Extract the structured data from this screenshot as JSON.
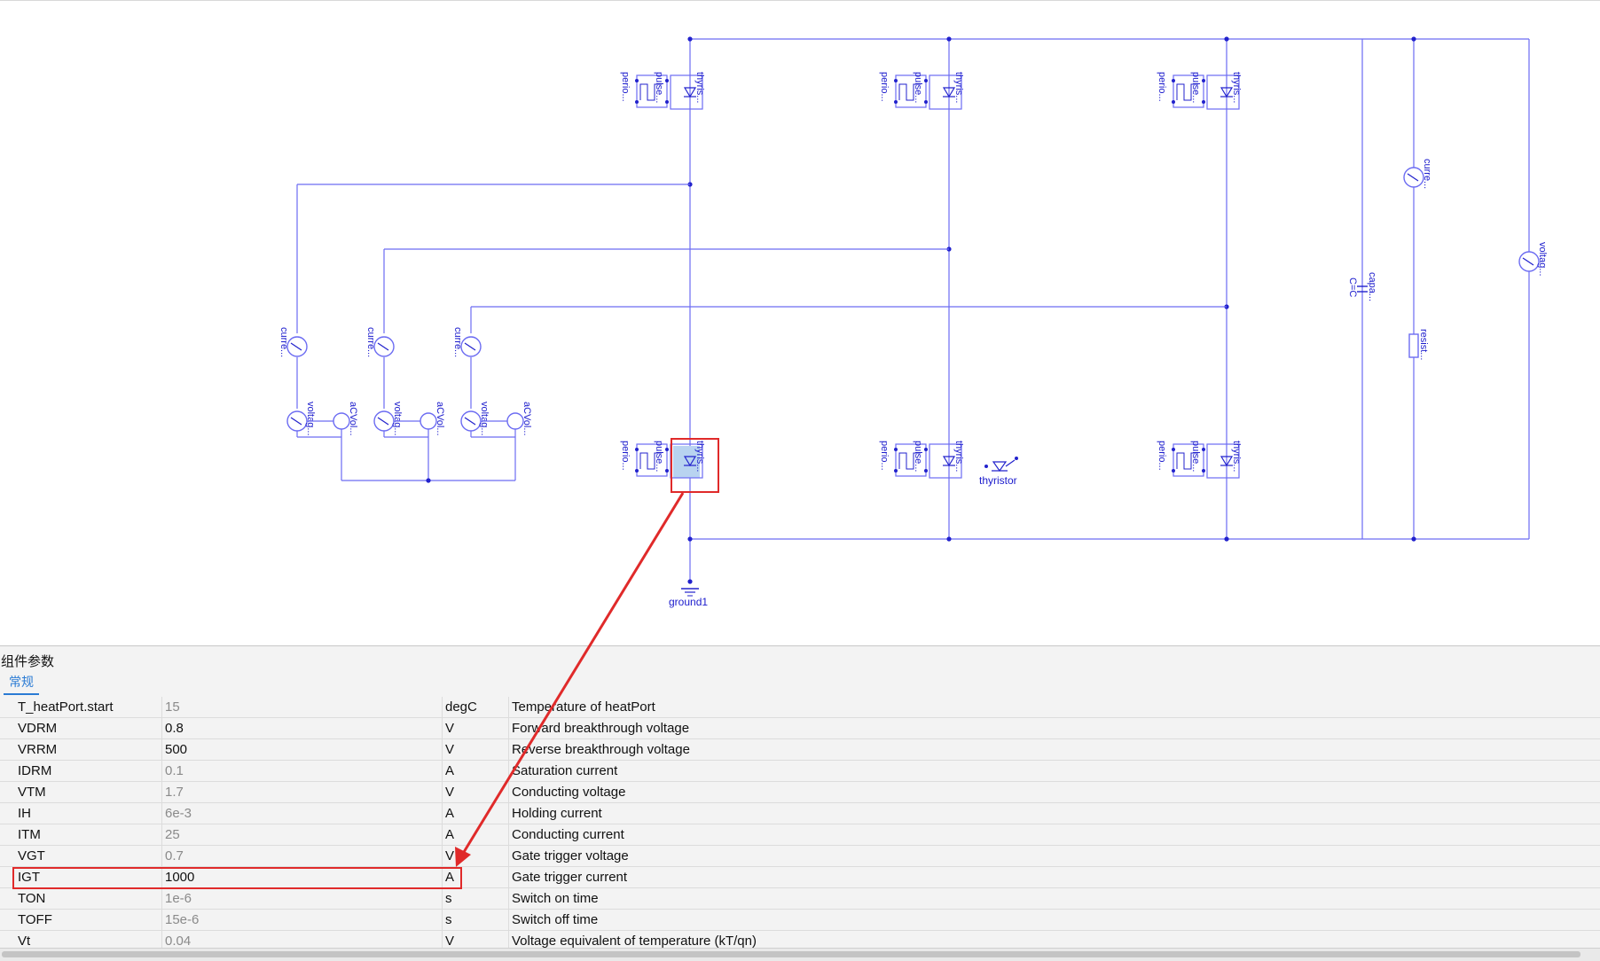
{
  "diagram": {
    "thyristor_top_label": "thyris...",
    "pulse_label": "pulse...",
    "period_label": "perio...",
    "current_sensor_label": "curre...",
    "voltage_sensor_label": "voltag...",
    "ac_source_label": "aCVol...",
    "capacitor_label": "capa...",
    "capacitor_param": "C=C",
    "resistor_label": "resist...",
    "thyristor_unplaced_label": "thyristor",
    "ground_label": "ground1",
    "wire_color": "#6c6cf2",
    "selection_color": "#b8d3f0"
  },
  "panel": {
    "title": "组件参数",
    "tab_general": "常规",
    "rows": [
      {
        "name": "T_heatPort.start",
        "value": "15",
        "unit": "degC",
        "desc": "Temperature of heatPort",
        "is_default": true
      },
      {
        "name": "VDRM",
        "value": "0.8",
        "unit": "V",
        "desc": "Forward breakthrough voltage",
        "is_default": false
      },
      {
        "name": "VRRM",
        "value": "500",
        "unit": "V",
        "desc": "Reverse breakthrough voltage",
        "is_default": false
      },
      {
        "name": "IDRM",
        "value": "0.1",
        "unit": "A",
        "desc": "Saturation current",
        "is_default": true
      },
      {
        "name": "VTM",
        "value": "1.7",
        "unit": "V",
        "desc": "Conducting voltage",
        "is_default": true
      },
      {
        "name": "IH",
        "value": "6e-3",
        "unit": "A",
        "desc": "Holding current",
        "is_default": true
      },
      {
        "name": "ITM",
        "value": "25",
        "unit": "A",
        "desc": "Conducting current",
        "is_default": true
      },
      {
        "name": "VGT",
        "value": "0.7",
        "unit": "V",
        "desc": "Gate trigger voltage",
        "is_default": true
      },
      {
        "name": "IGT",
        "value": "1000",
        "unit": "A",
        "desc": "Gate trigger current",
        "is_default": false
      },
      {
        "name": "TON",
        "value": "1e-6",
        "unit": "s",
        "desc": "Switch on time",
        "is_default": true
      },
      {
        "name": "TOFF",
        "value": "15e-6",
        "unit": "s",
        "desc": "Switch off time",
        "is_default": true
      },
      {
        "name": "Vt",
        "value": "0.04",
        "unit": "V",
        "desc": "Voltage equivalent of temperature (kT/qn)",
        "is_default": true
      }
    ],
    "highlight_color": "#e02a2a"
  }
}
